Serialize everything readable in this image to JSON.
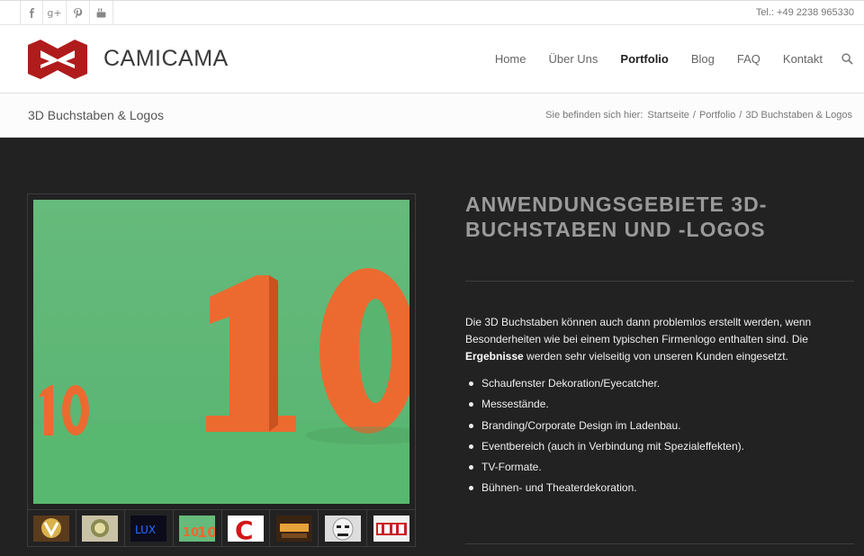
{
  "topbar": {
    "socials": [
      {
        "icon": "facebook-icon",
        "glyph": "f"
      },
      {
        "icon": "google-plus-icon",
        "glyph": "g+"
      },
      {
        "icon": "pinterest-icon",
        "glyph": "p"
      },
      {
        "icon": "youtube-icon",
        "glyph": "yt"
      }
    ],
    "phone": "Tel.: +49 2238 965330"
  },
  "header": {
    "logo_text": "CAMICAMA",
    "logo_color": "#b01c1c",
    "nav": [
      {
        "label": "Home",
        "active": false
      },
      {
        "label": "Über Uns",
        "active": false
      },
      {
        "label": "Portfolio",
        "active": true
      },
      {
        "label": "Blog",
        "active": false
      },
      {
        "label": "FAQ",
        "active": false
      },
      {
        "label": "Kontakt",
        "active": false
      }
    ]
  },
  "titlebar": {
    "title": "3D Buchstaben & Logos",
    "breadcrumb_label": "Sie befinden sich hier:",
    "crumbs": [
      "Startseite",
      "Portfolio",
      "3D Buchstaben & Logos"
    ]
  },
  "gallery": {
    "main_image": "orange-3d-numbers-10-on-green-background",
    "thumbnails": [
      "gold-letter-v-logo",
      "round-crest-logo",
      "blue-led-letters",
      "orange-10-on-green",
      "red-letter-c-on-white",
      "illuminated-sign",
      "white-mask-face",
      "red-letters-on-white"
    ]
  },
  "content": {
    "heading": "Anwendungsgebiete 3D-Buchstaben und -Logos",
    "para_part1": "Die 3D Buchstaben können auch dann problemlos erstellt werden, wenn Besonderheiten wie bei einem typischen Firmenlogo enthalten sind. Die ",
    "para_bold": "Ergebnisse",
    "para_part2": " werden sehr vielseitig von unseren Kunden eingesetzt.",
    "list": [
      "Schaufenster Dekoration/Eyecatcher.",
      "Messestände.",
      "Branding/Corporate Design im Ladenbau.",
      "Eventbereich (auch in Verbindung mit Spezialeffekten).",
      "TV-Formate.",
      "Bühnen- und Theaterdekoration."
    ]
  }
}
